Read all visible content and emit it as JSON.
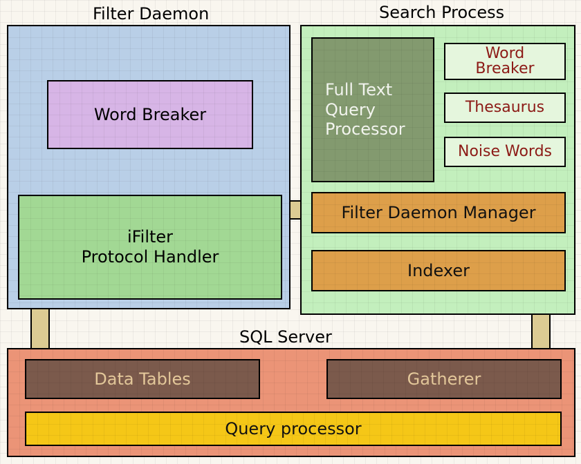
{
  "titles": {
    "filter_daemon": "Filter Daemon",
    "search_process": "Search Process",
    "sql_server": "SQL Server"
  },
  "filter_daemon": {
    "word_breaker": "Word Breaker",
    "ifilter_line1": "iFilter",
    "ifilter_line2": "Protocol Handler"
  },
  "search_process": {
    "ftqp_line1": "Full Text",
    "ftqp_line2": "Query",
    "ftqp_line3": "Processor",
    "word_breaker_line1": "Word",
    "word_breaker_line2": "Breaker",
    "thesaurus": "Thesaurus",
    "noise_words": "Noise Words",
    "filter_daemon_manager": "Filter Daemon Manager",
    "indexer": "Indexer"
  },
  "sql_server": {
    "data_tables": "Data Tables",
    "gatherer": "Gatherer",
    "query_processor": "Query processor"
  }
}
